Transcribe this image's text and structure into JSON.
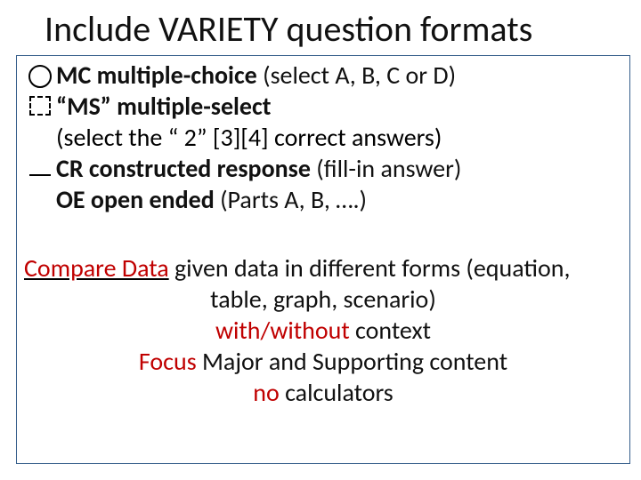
{
  "title": "Include VARIETY question formats",
  "formats": {
    "mc": {
      "label": "MC multiple-choice",
      "desc": " (select  A, B, C or D)"
    },
    "ms": {
      "label": "“MS” multiple-select",
      "desc": "(select the “ 2” [3][4]  correct answers)"
    },
    "cr": {
      "label": "CR constructed response",
      "desc": " (fill-in answer)"
    },
    "oe": {
      "label": "OE open ended",
      "desc": " (Parts A, B, ….)"
    }
  },
  "compare": {
    "lead": "Compare Data",
    "tail1": " given data in different forms (equation,",
    "line2": "table, graph, scenario)",
    "line3a": "with/without",
    "line3b": " context",
    "line4a": "Focus",
    "line4b": " Major and Supporting content",
    "line5a": "no",
    "line5b": " calculators"
  }
}
